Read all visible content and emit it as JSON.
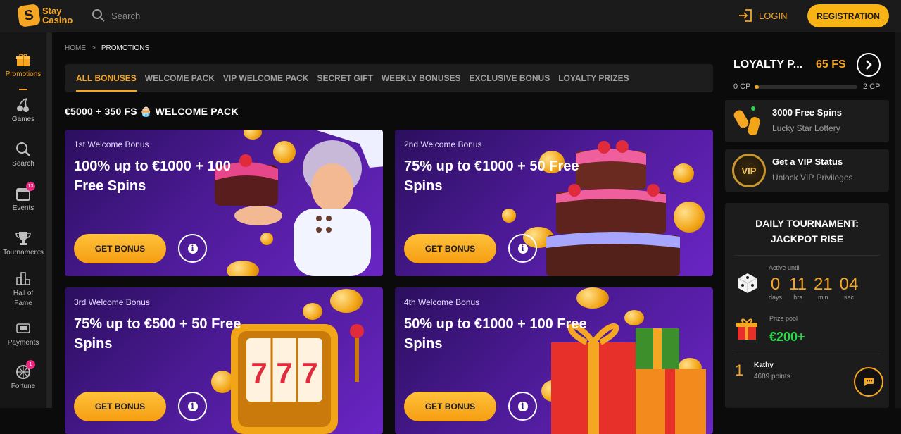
{
  "header": {
    "logo_text_1": "Stay",
    "logo_text_2": "Casino",
    "logo_mark": "S",
    "search_placeholder": "Search",
    "login_label": "LOGIN",
    "registration_label": "REGISTRATION"
  },
  "sidebar": {
    "items": [
      {
        "label": "Promotions",
        "icon": "gift-icon",
        "active": true
      },
      {
        "label": "Games",
        "icon": "cherry-icon"
      },
      {
        "label": "Search",
        "icon": "search-icon"
      },
      {
        "label": "Events",
        "icon": "calendar-icon",
        "badge": "13"
      },
      {
        "label": "Tournaments",
        "icon": "trophy-icon"
      },
      {
        "label": "Hall of Fame",
        "icon": "podium-icon"
      },
      {
        "label": "Payments",
        "icon": "card-icon"
      },
      {
        "label": "Fortune",
        "icon": "wheel-icon",
        "badge": "1"
      }
    ]
  },
  "breadcrumb": {
    "home": "HOME",
    "separator": ">",
    "current": "PROMOTIONS"
  },
  "tabs": [
    "ALL BONUSES",
    "WELCOME PACK",
    "VIP WELCOME PACK",
    "SECRET GIFT",
    "WEEKLY BONUSES",
    "EXCLUSIVE BONUS",
    "LOYALTY PRIZES"
  ],
  "section": {
    "title": "€5000 + 350 FS 🧁 WELCOME PACK"
  },
  "cards": [
    {
      "label": "1st Welcome Bonus",
      "headline": "100% up to €1000 + 100 Free Spins",
      "button": "GET BONUS",
      "info": "i"
    },
    {
      "label": "2nd Welcome Bonus",
      "headline": "75% up to €1000 + 50 Free Spins",
      "button": "GET BONUS",
      "info": "i"
    },
    {
      "label": "3rd Welcome Bonus",
      "headline": "75% up to €500 + 50 Free Spins",
      "button": "GET BONUS",
      "info": "i"
    },
    {
      "label": "4th Welcome Bonus",
      "headline": "50% up to €1000 + 100 Free Spins",
      "button": "GET BONUS",
      "info": "i"
    }
  ],
  "slot_digits": "777",
  "loyalty": {
    "title": "LOYALTY P...",
    "fs": "65 FS",
    "cp_min": "0 CP",
    "cp_max": "2 CP",
    "progress": 0.04
  },
  "promos": [
    {
      "title": "3000 Free Spins",
      "subtitle": "Lucky Star Lottery",
      "icon": "coins-icon"
    },
    {
      "title": "Get a VIP Status",
      "subtitle": "Unlock VIP Privileges",
      "icon": "vip-icon",
      "badge_text": "VIP"
    }
  ],
  "tournament": {
    "title_line1": "DAILY TOURNAMENT:",
    "title_line2": "JACKPOT RISE",
    "active_until": "Active until",
    "timer": [
      {
        "n": "0",
        "u": "days"
      },
      {
        "n": "11",
        "u": "hrs"
      },
      {
        "n": "21",
        "u": "min"
      },
      {
        "n": "04",
        "u": "sec"
      }
    ],
    "prize_label": "Prize pool",
    "prize_value": "€200+",
    "leader": {
      "rank": "1",
      "name": "Kathy",
      "points": "4689 points"
    }
  },
  "colors": {
    "accent": "#f5a623",
    "button": "#f8b315",
    "card_purple": "#4b1a94",
    "prize_green": "#2bd44b",
    "badge_pink": "#e7287c"
  }
}
